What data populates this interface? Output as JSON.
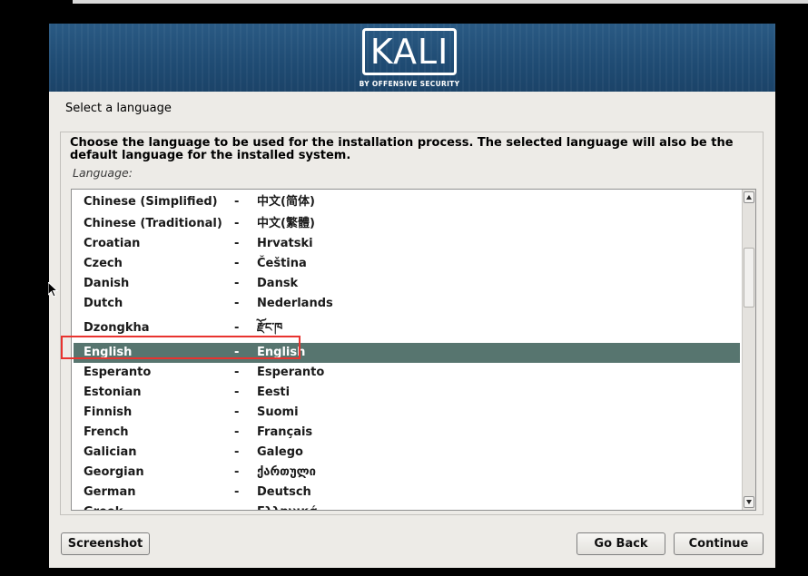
{
  "banner": {
    "logo_text": "KALI",
    "logo_subtitle": "BY OFFENSIVE SECURITY",
    "background_color": "#1f4b73"
  },
  "page_title": "Select a language",
  "instruction": "Choose the language to be used for the installation process. The selected language will also be the default language for the installed system.",
  "language_label": "Language:",
  "languages": [
    {
      "name": "Chinese (Simplified)",
      "separator": "-",
      "native": "中文(简体)"
    },
    {
      "name": "Chinese (Traditional)",
      "separator": "-",
      "native": "中文(繁體)"
    },
    {
      "name": "Croatian",
      "separator": "-",
      "native": "Hrvatski"
    },
    {
      "name": "Czech",
      "separator": "-",
      "native": "Čeština"
    },
    {
      "name": "Danish",
      "separator": "-",
      "native": "Dansk"
    },
    {
      "name": "Dutch",
      "separator": "-",
      "native": "Nederlands"
    },
    {
      "name": "Dzongkha",
      "separator": "-",
      "native": "རྫོང་ཁ"
    },
    {
      "name": "English",
      "separator": "-",
      "native": "English"
    },
    {
      "name": "Esperanto",
      "separator": "-",
      "native": "Esperanto"
    },
    {
      "name": "Estonian",
      "separator": "-",
      "native": "Eesti"
    },
    {
      "name": "Finnish",
      "separator": "-",
      "native": "Suomi"
    },
    {
      "name": "French",
      "separator": "-",
      "native": "Français"
    },
    {
      "name": "Galician",
      "separator": "-",
      "native": "Galego"
    },
    {
      "name": "Georgian",
      "separator": "-",
      "native": "ქართული"
    },
    {
      "name": "German",
      "separator": "-",
      "native": "Deutsch"
    },
    {
      "name": "Greek",
      "separator": "-",
      "native": "Ελληνικά"
    }
  ],
  "selected_language": "English",
  "selection_color": "#57756f",
  "annotation_color": "#e8332f",
  "buttons": {
    "screenshot": "Screenshot",
    "go_back": "Go Back",
    "continue": "Continue"
  }
}
